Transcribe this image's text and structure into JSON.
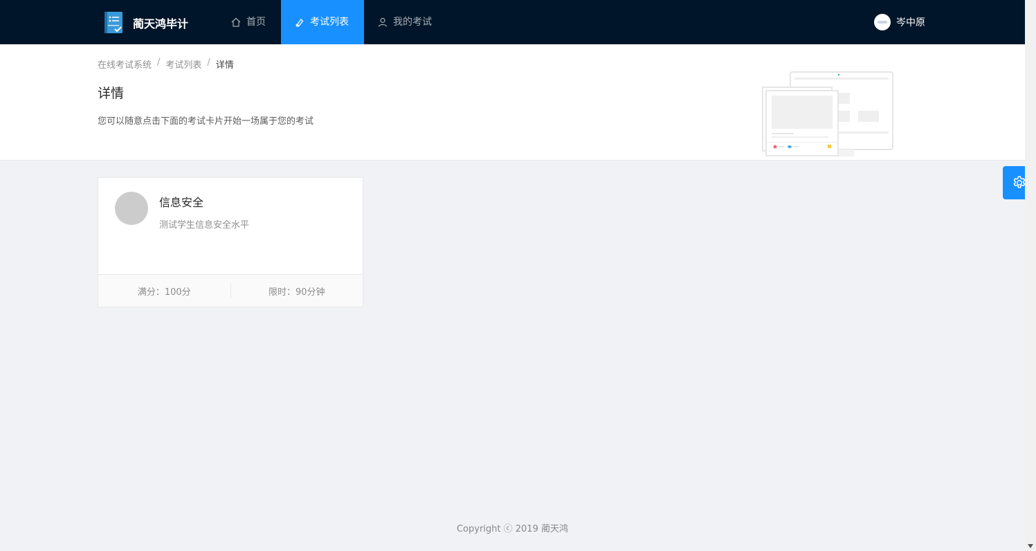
{
  "nav": {
    "brand": "蔺天鸿毕计",
    "items": [
      {
        "label": "首页",
        "icon": "home-icon",
        "active": false
      },
      {
        "label": "考试列表",
        "icon": "exam-list-icon",
        "active": true
      },
      {
        "label": "我的考试",
        "icon": "user-icon",
        "active": false
      }
    ],
    "user": "岑中原"
  },
  "header": {
    "breadcrumb": [
      "在线考试系统",
      "考试列表",
      "详情"
    ],
    "separator": "/",
    "title": "详情",
    "description": "您可以随意点击下面的考试卡片开始一场属于您的考试"
  },
  "card": {
    "title": "信息安全",
    "description": "测试学生信息安全水平",
    "full_score": "满分：100分",
    "time_limit": "限时：90分钟"
  },
  "footer": "Copyright ⓒ 2019 蔺天鸿",
  "colors": {
    "nav_bg": "#001529",
    "primary": "#1890ff",
    "page_bg": "#f0f2f5"
  }
}
